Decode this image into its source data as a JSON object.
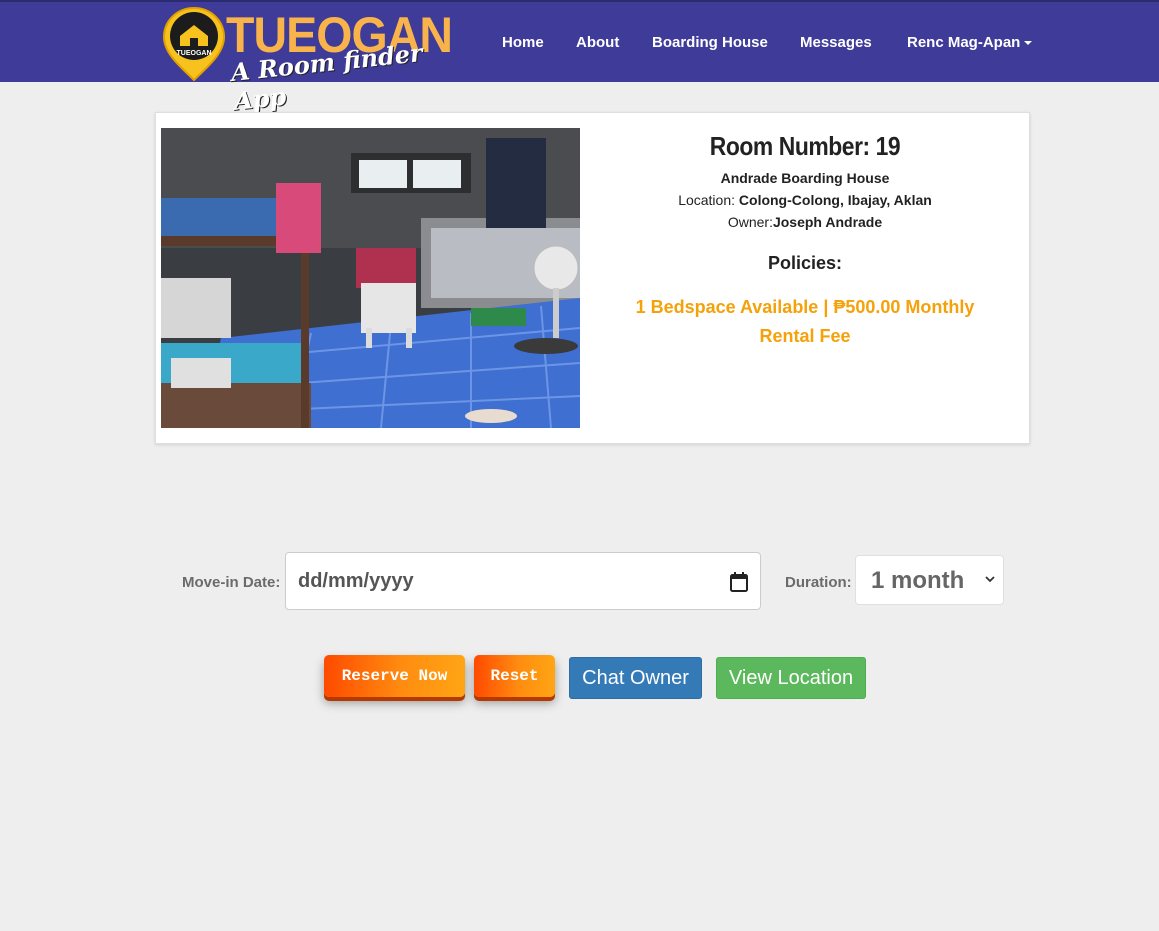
{
  "brand": {
    "name": "TUEOGAN",
    "tagline": "A Room finder App",
    "pin_label": "TUEOGAN",
    "colors": {
      "nav_bg": "#3f3b99",
      "logo": "#f8b34a",
      "accent_orange": "#f5a20a"
    }
  },
  "nav": {
    "items": [
      "Home",
      "About",
      "Boarding House",
      "Messages",
      "Renc Mag-Apan"
    ]
  },
  "room": {
    "title": "Room Number: 19",
    "boarding_house": "Andrade Boarding House",
    "location_label": "Location: ",
    "location_value": "Colong-Colong, Ibajay, Aklan",
    "owner_label": "Owner:",
    "owner_value": "Joseph Andrade",
    "policies_title": "Policies:",
    "policy_text": "1 Bedspace Available | ₱500.00 Monthly Rental Fee"
  },
  "form": {
    "move_in_label": "Move-in Date:",
    "date_placeholder": "dd/mm/yyyy",
    "duration_label": "Duration:",
    "duration_value": "1 month"
  },
  "buttons": {
    "reserve": "Reserve Now",
    "reset": "Reset",
    "chat": "Chat Owner",
    "location": "View Location"
  }
}
